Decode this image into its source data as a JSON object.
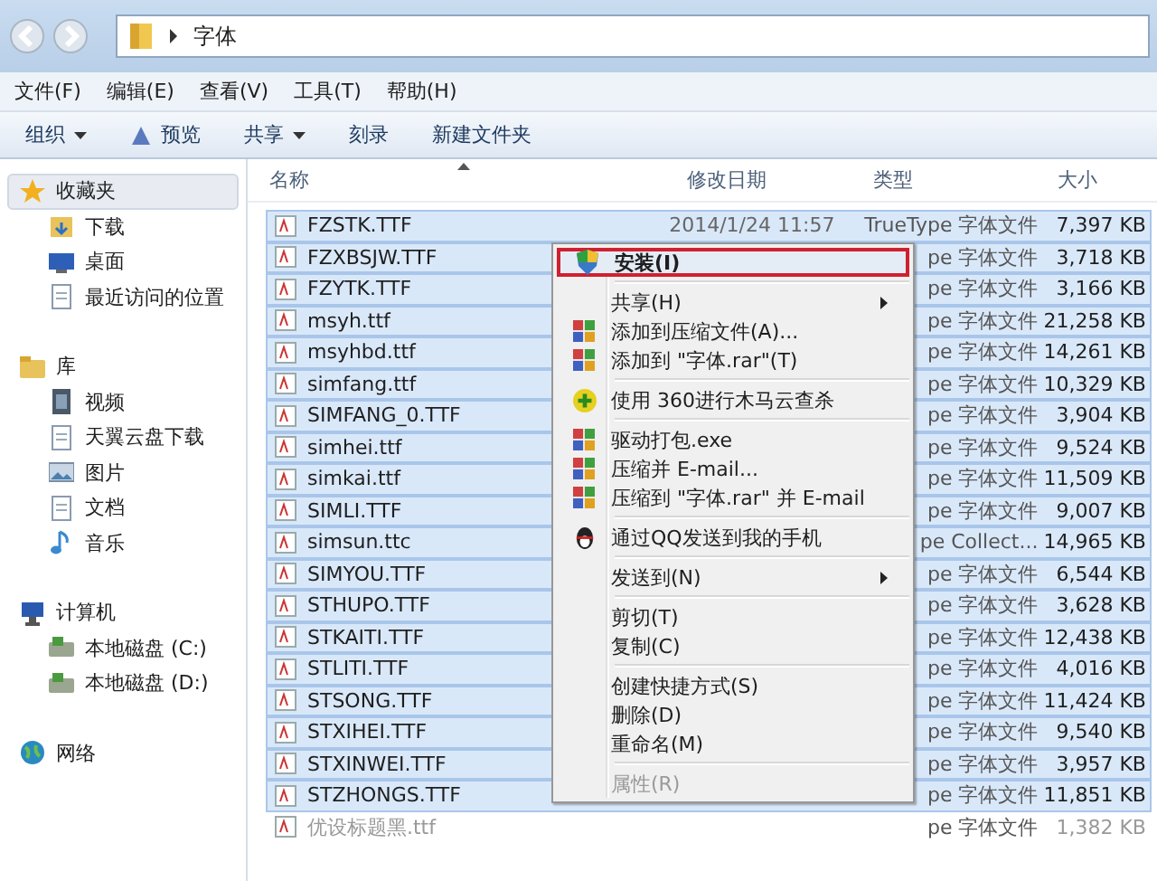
{
  "address_bar": {
    "path": [
      "字体"
    ]
  },
  "menu_bar": [
    "文件(F)",
    "编辑(E)",
    "查看(V)",
    "工具(T)",
    "帮助(H)"
  ],
  "toolbar": [
    {
      "label": "组织",
      "dropdown": true
    },
    {
      "label": "预览",
      "dropdown": false
    },
    {
      "label": "共享",
      "dropdown": true
    },
    {
      "label": "刻录",
      "dropdown": false
    },
    {
      "label": "新建文件夹",
      "dropdown": false
    }
  ],
  "sidebar": [
    {
      "label": "收藏夹",
      "selected": true,
      "children": [
        {
          "label": "下载",
          "selected": false
        },
        {
          "label": "桌面",
          "selected": false
        },
        {
          "label": "最近访问的位置",
          "selected": false
        }
      ]
    },
    {
      "label": "库",
      "selected": false,
      "children": [
        {
          "label": "视频",
          "selected": false
        },
        {
          "label": "天翼云盘下载",
          "selected": false
        },
        {
          "label": "图片",
          "selected": false
        },
        {
          "label": "文档",
          "selected": false
        },
        {
          "label": "音乐",
          "selected": false
        }
      ]
    },
    {
      "label": "计算机",
      "selected": false,
      "children": [
        {
          "label": "本地磁盘 (C:)",
          "selected": false
        },
        {
          "label": "本地磁盘 (D:)",
          "selected": false
        }
      ]
    },
    {
      "label": "网络",
      "selected": false
    }
  ],
  "file_list": {
    "columns": [
      "名称",
      "修改日期",
      "类型",
      "大小"
    ],
    "rows": [
      {
        "name": "FZSTK.TTF",
        "date": "2014/1/24 11:57",
        "type": "TrueType 字体文件",
        "size": "7,397 KB",
        "selected": true
      },
      {
        "name": "FZXBSJW.TTF",
        "type": "pe 字体文件",
        "size": "3,718 KB",
        "selected": true
      },
      {
        "name": "FZYTK.TTF",
        "type": "pe 字体文件",
        "size": "3,166 KB",
        "selected": true
      },
      {
        "name": "msyh.ttf",
        "type": "pe 字体文件",
        "size": "21,258 KB",
        "selected": true
      },
      {
        "name": "msyhbd.ttf",
        "type": "pe 字体文件",
        "size": "14,261 KB",
        "selected": true
      },
      {
        "name": "simfang.ttf",
        "type": "pe 字体文件",
        "size": "10,329 KB",
        "selected": true
      },
      {
        "name": "SIMFANG_0.TTF",
        "type": "pe 字体文件",
        "size": "3,904 KB",
        "selected": true
      },
      {
        "name": "simhei.ttf",
        "type": "pe 字体文件",
        "size": "9,524 KB",
        "selected": true
      },
      {
        "name": "simkai.ttf",
        "type": "pe 字体文件",
        "size": "11,509 KB",
        "selected": true
      },
      {
        "name": "SIMLI.TTF",
        "type": "pe 字体文件",
        "size": "9,007 KB",
        "selected": true
      },
      {
        "name": "simsun.ttc",
        "type": "pe Collect...",
        "size": "14,965 KB",
        "selected": true
      },
      {
        "name": "SIMYOU.TTF",
        "type": "pe 字体文件",
        "size": "6,544 KB",
        "selected": true
      },
      {
        "name": "STHUPO.TTF",
        "type": "pe 字体文件",
        "size": "3,628 KB",
        "selected": true
      },
      {
        "name": "STKAITI.TTF",
        "type": "pe 字体文件",
        "size": "12,438 KB",
        "selected": true
      },
      {
        "name": "STLITI.TTF",
        "type": "pe 字体文件",
        "size": "4,016 KB",
        "selected": true
      },
      {
        "name": "STSONG.TTF",
        "type": "pe 字体文件",
        "size": "11,424 KB",
        "selected": true
      },
      {
        "name": "STXIHEI.TTF",
        "type": "pe 字体文件",
        "size": "9,540 KB",
        "selected": true
      },
      {
        "name": "STXINWEI.TTF",
        "type": "pe 字体文件",
        "size": "3,957 KB",
        "selected": true
      },
      {
        "name": "STZHONGS.TTF",
        "type": "pe 字体文件",
        "size": "11,851 KB",
        "selected": true
      },
      {
        "name": "优设标题黑.ttf",
        "type": "pe 字体文件",
        "size": "1,382 KB",
        "selected": false
      }
    ]
  },
  "context_menu": [
    {
      "kind": "item",
      "label": "安装(I)",
      "selected": true,
      "submenu": false,
      "disabled": false
    },
    {
      "kind": "separator"
    },
    {
      "kind": "item",
      "label": "共享(H)",
      "selected": false,
      "submenu": true,
      "disabled": false
    },
    {
      "kind": "item",
      "label": "添加到压缩文件(A)...",
      "selected": false,
      "submenu": false,
      "disabled": false
    },
    {
      "kind": "item",
      "label": "添加到 \"字体.rar\"(T)",
      "selected": false,
      "submenu": false,
      "disabled": false
    },
    {
      "kind": "separator"
    },
    {
      "kind": "item",
      "label": "使用 360进行木马云查杀",
      "selected": false,
      "submenu": false,
      "disabled": false
    },
    {
      "kind": "separator"
    },
    {
      "kind": "item",
      "label": "驱动打包.exe",
      "selected": false,
      "submenu": false,
      "disabled": false
    },
    {
      "kind": "item",
      "label": "压缩并 E-mail...",
      "selected": false,
      "submenu": false,
      "disabled": false
    },
    {
      "kind": "item",
      "label": "压缩到 \"字体.rar\" 并 E-mail",
      "selected": false,
      "submenu": false,
      "disabled": false
    },
    {
      "kind": "separator"
    },
    {
      "kind": "item",
      "label": "通过QQ发送到我的手机",
      "selected": false,
      "submenu": false,
      "disabled": false
    },
    {
      "kind": "separator"
    },
    {
      "kind": "item",
      "label": "发送到(N)",
      "selected": false,
      "submenu": true,
      "disabled": false
    },
    {
      "kind": "separator"
    },
    {
      "kind": "item",
      "label": "剪切(T)",
      "selected": false,
      "submenu": false,
      "disabled": false
    },
    {
      "kind": "item",
      "label": "复制(C)",
      "selected": false,
      "submenu": false,
      "disabled": false
    },
    {
      "kind": "separator"
    },
    {
      "kind": "item",
      "label": "创建快捷方式(S)",
      "selected": false,
      "submenu": false,
      "disabled": false
    },
    {
      "kind": "item",
      "label": "删除(D)",
      "selected": false,
      "submenu": false,
      "disabled": false
    },
    {
      "kind": "item",
      "label": "重命名(M)",
      "selected": false,
      "submenu": false,
      "disabled": false
    },
    {
      "kind": "separator"
    },
    {
      "kind": "item",
      "label": "属性(R)",
      "selected": false,
      "submenu": false,
      "disabled": true
    }
  ]
}
